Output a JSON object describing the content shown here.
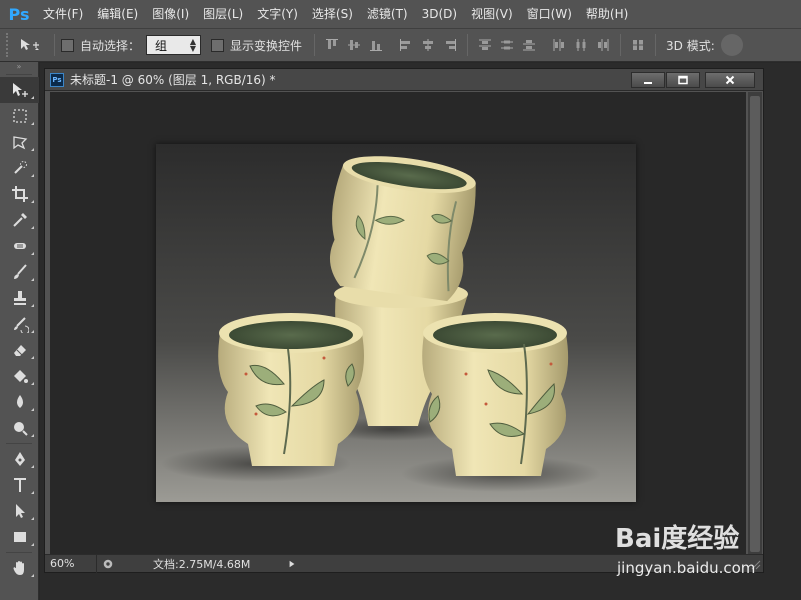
{
  "app": {
    "logo": "Ps"
  },
  "menu": {
    "items": [
      "文件(F)",
      "编辑(E)",
      "图像(I)",
      "图层(L)",
      "文字(Y)",
      "选择(S)",
      "滤镜(T)",
      "3D(D)",
      "视图(V)",
      "窗口(W)",
      "帮助(H)"
    ]
  },
  "options": {
    "auto_select_label": "自动选择：",
    "auto_select_value": "组",
    "show_transform_label": "显示变换控件",
    "mode_label": "3D 模式:"
  },
  "document": {
    "title": "未标题-1 @ 60% (图层 1, RGB/16) *",
    "zoom": "60%",
    "doc_info": "文档:2.75M/4.68M",
    "icon_label": "Ps"
  },
  "watermark": {
    "brand": "Bai度经验",
    "url": "jingyan.baidu.com"
  },
  "icons": {
    "move": "move-icon",
    "marquee": "marquee-icon",
    "lasso": "lasso-icon",
    "quick_select": "quick-select-icon",
    "crop": "crop-icon",
    "eyedropper": "eyedropper-icon",
    "healing": "healing-brush-icon",
    "brush": "brush-icon",
    "stamp": "clone-stamp-icon",
    "history_brush": "history-brush-icon",
    "eraser": "eraser-icon",
    "bucket": "paint-bucket-icon",
    "blur": "blur-icon",
    "dodge": "dodge-icon",
    "pen": "pen-icon",
    "type": "type-icon",
    "path_select": "path-selection-icon",
    "shape": "rectangle-shape-icon",
    "hand": "hand-icon"
  },
  "colors": {
    "panel": "#535353",
    "canvas_bg": "#282828",
    "accent": "#31a8ff"
  }
}
